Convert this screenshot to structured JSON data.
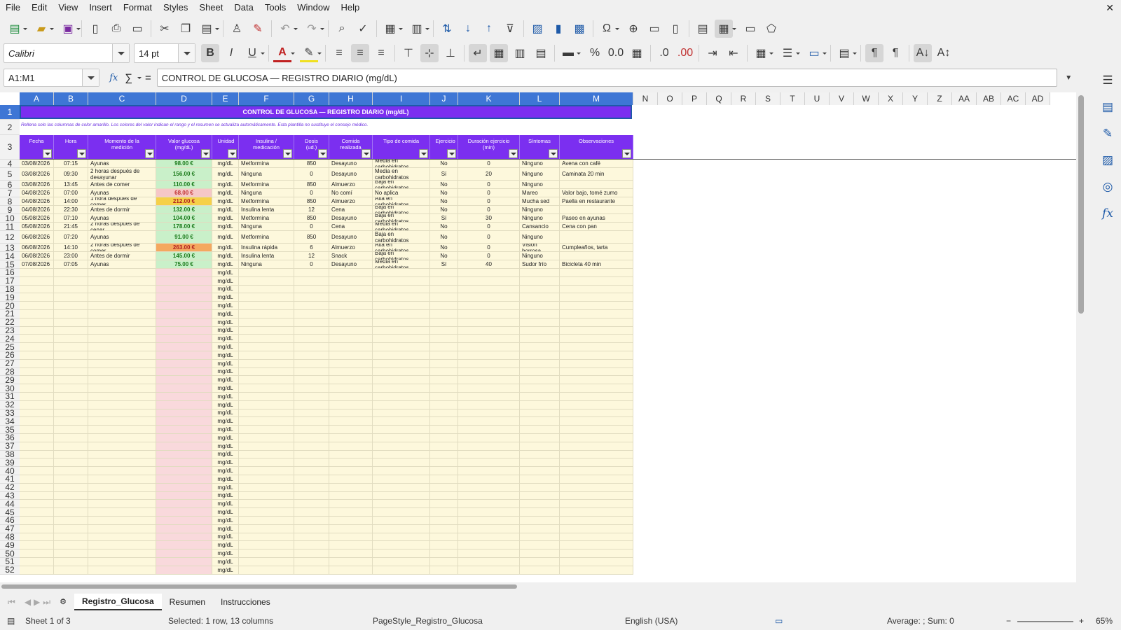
{
  "menu": [
    "File",
    "Edit",
    "View",
    "Insert",
    "Format",
    "Styles",
    "Sheet",
    "Data",
    "Tools",
    "Window",
    "Help"
  ],
  "menu_close": "✕",
  "toolbar": {
    "font_name": "Calibri",
    "font_size": "14 pt",
    "bold": "B",
    "italic": "I",
    "underline": "U",
    "percent": "%"
  },
  "formula_bar": {
    "name_box": "A1:M1",
    "fx": "fx",
    "sigma": "∑",
    "equals": "=",
    "content": "CONTROL DE GLUCOSA — REGISTRO DIARIO (mg/dL)"
  },
  "columns": [
    "A",
    "B",
    "C",
    "D",
    "E",
    "F",
    "G",
    "H",
    "I",
    "J",
    "K",
    "L",
    "M",
    "N",
    "O",
    "P",
    "Q",
    "R",
    "S",
    "T",
    "U",
    "V",
    "W",
    "X",
    "Y",
    "Z",
    "AA",
    "AB",
    "AC",
    "AD"
  ],
  "sheet": {
    "title": "CONTROL DE GLUCOSA — REGISTRO DIARIO (mg/dL)",
    "note": "Rellena solo las columnas de color amarillo. Los colores del valor indican el rango y el resumen se actualiza automáticamente. Esta plantilla no sustituye el consejo médico.",
    "headers": [
      "Fecha",
      "Hora",
      "Momento de la medición",
      "Valor glucosa (mg/dL)",
      "Unidad",
      "Insulina / medicación",
      "Dosis (ud.)",
      "Comida realizada",
      "Tipo de comida",
      "Ejercicio",
      "Duración ejercicio (min)",
      "Síntomas",
      "Observaciones"
    ],
    "rows": [
      [
        "03/08/2026",
        "07:15",
        "Ayunas",
        "98.00 €",
        "mg/dL",
        "Metformina",
        "850",
        "Desayuno",
        "Media en carbohidratos",
        "No",
        "0",
        "Ninguno",
        "Avena con café"
      ],
      [
        "03/08/2026",
        "09:30",
        "2 horas después de desayunar",
        "156.00 €",
        "mg/dL",
        "Ninguna",
        "0",
        "Desayuno",
        "Media en carbohidratos",
        "Sí",
        "20",
        "Ninguno",
        "Caminata 20 min"
      ],
      [
        "03/08/2026",
        "13:45",
        "Antes de comer",
        "110.00 €",
        "mg/dL",
        "Metformina",
        "850",
        "Almuerzo",
        "Baja en carbohidratos",
        "No",
        "0",
        "Ninguno",
        ""
      ],
      [
        "04/08/2026",
        "07:00",
        "Ayunas",
        "68.00 €",
        "mg/dL",
        "Ninguna",
        "0",
        "No comí",
        "No aplica",
        "No",
        "0",
        "Mareo",
        "Valor bajo, tomé zumo"
      ],
      [
        "04/08/2026",
        "14:00",
        "1 hora después de comer",
        "212.00 €",
        "mg/dL",
        "Metformina",
        "850",
        "Almuerzo",
        "Alta en carbohidratos",
        "No",
        "0",
        "Mucha sed",
        "Paella en restaurante"
      ],
      [
        "04/08/2026",
        "22:30",
        "Antes de dormir",
        "132.00 €",
        "mg/dL",
        "Insulina lenta",
        "12",
        "Cena",
        "Baja en carbohidratos",
        "No",
        "0",
        "Ninguno",
        ""
      ],
      [
        "05/08/2026",
        "07:10",
        "Ayunas",
        "104.00 €",
        "mg/dL",
        "Metformina",
        "850",
        "Desayuno",
        "Baja en carbohidratos",
        "Sí",
        "30",
        "Ninguno",
        "Paseo en ayunas"
      ],
      [
        "05/08/2026",
        "21:45",
        "2 horas después de cenar",
        "178.00 €",
        "mg/dL",
        "Ninguna",
        "0",
        "Cena",
        "Media en carbohidratos",
        "No",
        "0",
        "Cansancio",
        "Cena con pan"
      ],
      [
        "06/08/2026",
        "07:20",
        "Ayunas",
        "91.00 €",
        "mg/dL",
        "Metformina",
        "850",
        "Desayuno",
        "Baja en carbohidratos",
        "No",
        "0",
        "Ninguno",
        ""
      ],
      [
        "06/08/2026",
        "14:10",
        "2 horas después de comer",
        "263.00 €",
        "mg/dL",
        "Insulina rápida",
        "6",
        "Almuerzo",
        "Alta en carbohidratos",
        "No",
        "0",
        "Visión borrosa",
        "Cumpleaños, tarta"
      ],
      [
        "06/08/2026",
        "23:00",
        "Antes de dormir",
        "145.00 €",
        "mg/dL",
        "Insulina lenta",
        "12",
        "Snack",
        "Baja en carbohidratos",
        "No",
        "0",
        "Ninguno",
        ""
      ],
      [
        "07/08/2026",
        "07:05",
        "Ayunas",
        "75.00 €",
        "mg/dL",
        "Ninguna",
        "0",
        "Desayuno",
        "Media en carbohidratos",
        "Sí",
        "40",
        "Sudor frío",
        "Bicicleta 40 min"
      ]
    ],
    "value_colors": [
      "#c9f0c9",
      "#c9f0c9",
      "#c9f0c9",
      "#f6c7c7",
      "#f6d048",
      "#c9f0c9",
      "#c9f0c9",
      "#c9f0c9",
      "#c9f0c9",
      "#f4a860",
      "#c9f0c9",
      "#c9f0c9"
    ],
    "value_text_colors": [
      "#1a7a1a",
      "#1a7a1a",
      "#1a7a1a",
      "#c03030",
      "#b02020",
      "#1a7a1a",
      "#1a7a1a",
      "#1a7a1a",
      "#1a7a1a",
      "#b02020",
      "#1a7a1a",
      "#1a7a1a"
    ],
    "empty_unit": "mg/dL",
    "row_numbers": [
      "1",
      "2",
      "3",
      "4",
      "5",
      "6",
      "7",
      "8",
      "9",
      "10",
      "11",
      "12",
      "13",
      "14",
      "15",
      "16",
      "17",
      "18",
      "19",
      "20",
      "21",
      "22",
      "23",
      "24",
      "25",
      "26",
      "27",
      "28",
      "29",
      "30",
      "31",
      "32",
      "33",
      "34",
      "35",
      "36",
      "37",
      "38",
      "39",
      "40",
      "41",
      "42",
      "43",
      "44",
      "45",
      "46",
      "47",
      "48",
      "49",
      "50",
      "51",
      "52"
    ]
  },
  "tabs": [
    "Registro_Glucosa",
    "Resumen",
    "Instrucciones"
  ],
  "status": {
    "sheet": "Sheet 1 of 3",
    "selection": "Selected: 1 row, 13 columns",
    "page_style": "PageStyle_Registro_Glucosa",
    "language": "English (USA)",
    "sum": "Average: ; Sum: 0",
    "zoom": "65%"
  },
  "colors": {
    "header_purple": "#7b2ff0",
    "input_yellow": "#fdf8dc",
    "selection_blue": "#3e76d5"
  }
}
